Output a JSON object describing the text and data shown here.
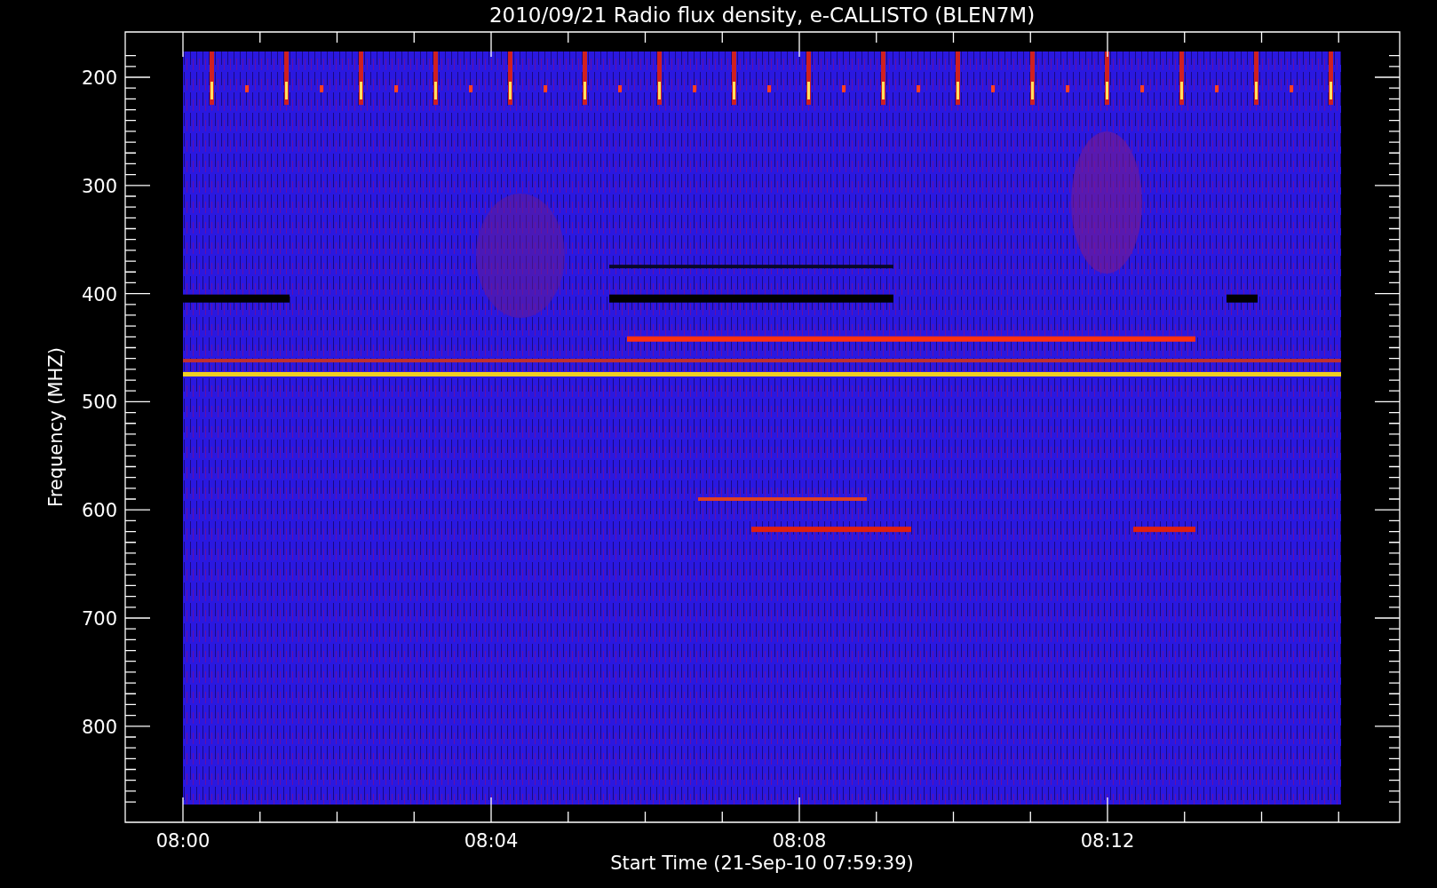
{
  "title": "2010/09/21  Radio flux density, e-CALLISTO (BLEN7M)",
  "y_axis": {
    "label": "Frequency (MHZ)",
    "ticks": [
      "200",
      "300",
      "400",
      "500",
      "600",
      "700",
      "800"
    ]
  },
  "x_axis": {
    "label": "Start Time (21-Sep-10 07:59:39)",
    "ticks": [
      "08:00",
      "08:04",
      "08:08",
      "08:12"
    ]
  }
}
